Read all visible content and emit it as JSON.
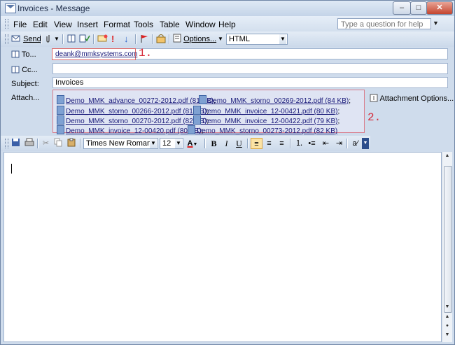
{
  "window": {
    "title": "Invoices - Message"
  },
  "menu": {
    "items": [
      "File",
      "Edit",
      "View",
      "Insert",
      "Format",
      "Tools",
      "Table",
      "Window",
      "Help"
    ],
    "help_placeholder": "Type a question for help"
  },
  "toolbar": {
    "send_label": "Send",
    "options_label": "Options...",
    "format_value": "HTML"
  },
  "header": {
    "to_label": "To...",
    "cc_label": "Cc...",
    "subject_label": "Subject:",
    "attach_label": "Attach...",
    "to_value": "deank@mmksystems.com",
    "subject_value": "Invoices",
    "attachment_options_label": "Attachment Options...",
    "attachments": [
      "Demo_MMK_advance_00272-2012.pdf (81 KB)",
      "Demo_MMK_storno_00269-2012.pdf (84 KB)",
      "Demo_MMK_storno_00266-2012.pdf (81 KB)",
      "Demo_MMK_invoice_12-00421.pdf (80 KB)",
      "Demo_MMK_storno_00270-2012.pdf (82 KB)",
      "Demo_MMK_invoice_12-00422.pdf (79 KB)",
      "Demo_MMK_invoice_12-00420.pdf (80 KB)",
      "Demo_MMK_storno_00273-2012.pdf (82 KB)"
    ],
    "attachment_separator": ";"
  },
  "annotations": {
    "marker1": "1.",
    "marker2": "2."
  },
  "formatting": {
    "font_name": "Times New Roman",
    "font_size": "12"
  },
  "icons": [
    "send-icon",
    "attach-icon",
    "address-book-icon",
    "check-names-icon",
    "importance-high-icon",
    "importance-low-icon",
    "flag-icon",
    "permissions-icon",
    "options-icon",
    "save-icon",
    "print-icon",
    "cut-icon",
    "copy-icon",
    "paste-icon",
    "font-color-icon",
    "bold-icon",
    "italic-icon",
    "underline-icon",
    "align-left-icon",
    "align-center-icon",
    "align-right-icon",
    "numbering-icon",
    "bullets-icon",
    "decrease-indent-icon",
    "increase-indent-icon",
    "style-icon"
  ],
  "colors": {
    "annotation": "#d52b3a",
    "frame": "#cfdcec"
  }
}
